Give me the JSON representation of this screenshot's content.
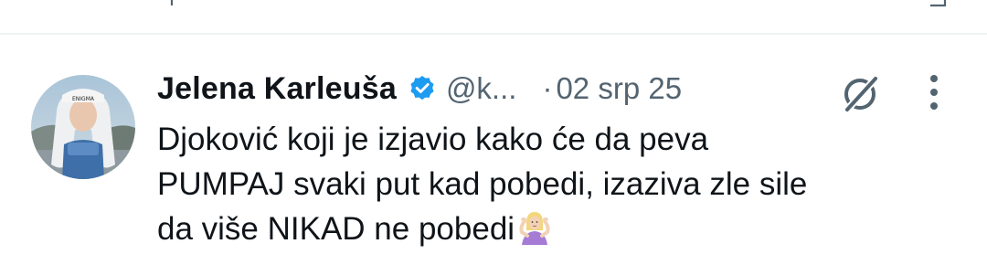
{
  "tweet": {
    "author_name": "Jelena Karleuša",
    "handle": "@k...",
    "separator": "·",
    "date": "02 srp 25",
    "text_lines": [
      "Djoković koji je izjavio kako će da peva",
      "PUMPAJ svaki put kad pobedi, izaziva zle sile",
      "da više NIKAD ne pobedi"
    ],
    "avatar_cap_text": "ENIGMA"
  },
  "icons": {
    "verified": "verified-badge-icon",
    "grok": "grok-icon",
    "more": "more-vertical-icon",
    "emoji": "person-shrugging-emoji"
  },
  "colors": {
    "text": "#0f1419",
    "secondary": "#536471",
    "verified": "#1d9bf0",
    "divider": "#eff3f4"
  }
}
